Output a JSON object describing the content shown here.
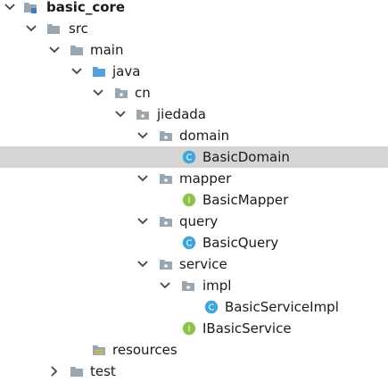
{
  "project_tree": {
    "nodes": [
      {
        "label": "basic_core",
        "expanded": true,
        "icon": "module-folder-icon"
      },
      {
        "label": "src",
        "expanded": true,
        "icon": "folder-icon"
      },
      {
        "label": "main",
        "expanded": true,
        "icon": "folder-icon"
      },
      {
        "label": "java",
        "expanded": true,
        "icon": "source-root-folder-icon"
      },
      {
        "label": "cn",
        "expanded": true,
        "icon": "package-icon"
      },
      {
        "label": "jiedada",
        "expanded": true,
        "icon": "package-icon"
      },
      {
        "label": "domain",
        "expanded": true,
        "icon": "package-icon"
      },
      {
        "label": "BasicDomain",
        "icon": "class-icon",
        "badge": "C",
        "selected": true
      },
      {
        "label": "mapper",
        "expanded": true,
        "icon": "package-icon"
      },
      {
        "label": "BasicMapper",
        "icon": "interface-icon",
        "badge": "I"
      },
      {
        "label": "query",
        "expanded": true,
        "icon": "package-icon"
      },
      {
        "label": "BasicQuery",
        "icon": "class-icon",
        "badge": "C"
      },
      {
        "label": "service",
        "expanded": true,
        "icon": "package-icon"
      },
      {
        "label": "impl",
        "expanded": true,
        "icon": "package-icon"
      },
      {
        "label": "BasicServiceImpl",
        "icon": "class-icon",
        "badge": "C"
      },
      {
        "label": "IBasicService",
        "icon": "interface-icon",
        "badge": "I"
      },
      {
        "label": "resources",
        "icon": "resources-folder-icon"
      },
      {
        "label": "test",
        "expanded": false,
        "icon": "folder-icon"
      }
    ]
  },
  "colors": {
    "selection": "#d5d5d5",
    "folder": "#9aa7b0",
    "source_root": "#5aa0d8",
    "class_badge": "#3fa5d6",
    "interface_badge": "#8bc34a",
    "chevron": "#444444"
  }
}
